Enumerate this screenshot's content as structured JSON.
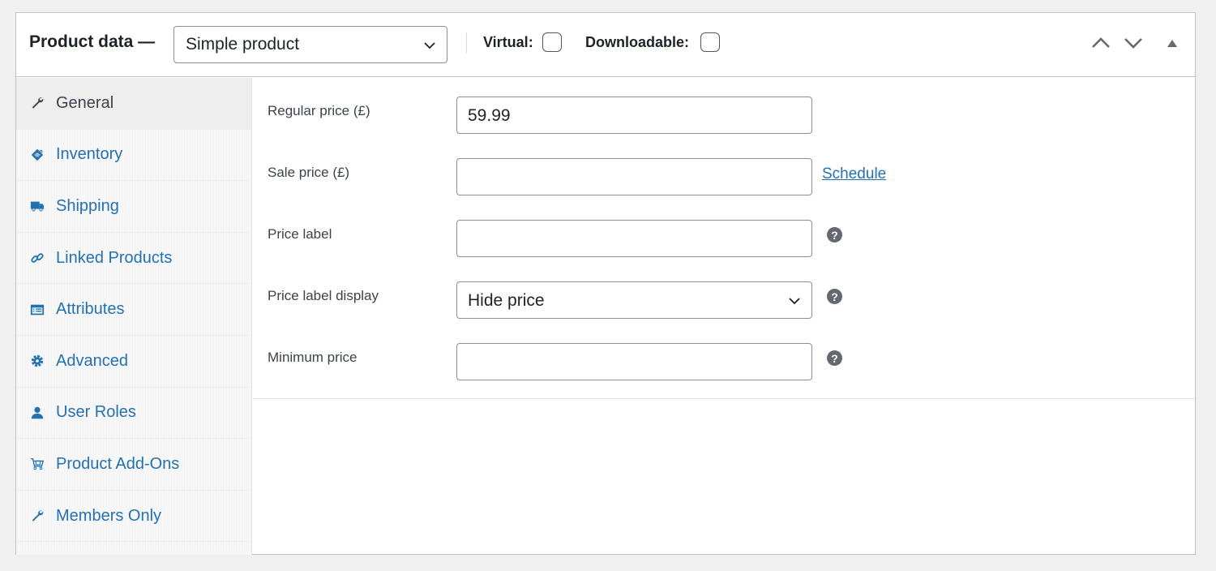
{
  "header": {
    "title": "Product data —",
    "product_type": "Simple product",
    "virtual_label": "Virtual:",
    "virtual_checked": false,
    "downloadable_label": "Downloadable:",
    "downloadable_checked": false,
    "move_up_icon": "chevron-up-icon",
    "move_down_icon": "chevron-down-icon",
    "toggle_icon": "triangle-up-icon"
  },
  "sidebar": {
    "items": [
      {
        "label": "General",
        "icon": "wrench-icon",
        "active": true
      },
      {
        "label": "Inventory",
        "icon": "tag-icon",
        "active": false
      },
      {
        "label": "Shipping",
        "icon": "truck-icon",
        "active": false
      },
      {
        "label": "Linked Products",
        "icon": "link-icon",
        "active": false
      },
      {
        "label": "Attributes",
        "icon": "list-view-icon",
        "active": false
      },
      {
        "label": "Advanced",
        "icon": "gear-icon",
        "active": false
      },
      {
        "label": "User Roles",
        "icon": "user-icon",
        "active": false
      },
      {
        "label": "Product Add-Ons",
        "icon": "cart-icon",
        "active": false
      },
      {
        "label": "Members Only",
        "icon": "wrench-icon",
        "active": false
      }
    ]
  },
  "form": {
    "regular_price": {
      "label": "Regular price (£)",
      "value": "59.99"
    },
    "sale_price": {
      "label": "Sale price (£)",
      "value": "",
      "schedule_link": "Schedule"
    },
    "price_label": {
      "label": "Price label",
      "value": "",
      "help": "?"
    },
    "price_label_display": {
      "label": "Price label display",
      "value": "Hide price",
      "help": "?"
    },
    "minimum_price": {
      "label": "Minimum price",
      "value": "",
      "help": "?"
    }
  },
  "colors": {
    "link": "#2271b1",
    "active_tab_bg": "#eeeeee",
    "help_icon": "#646970"
  }
}
